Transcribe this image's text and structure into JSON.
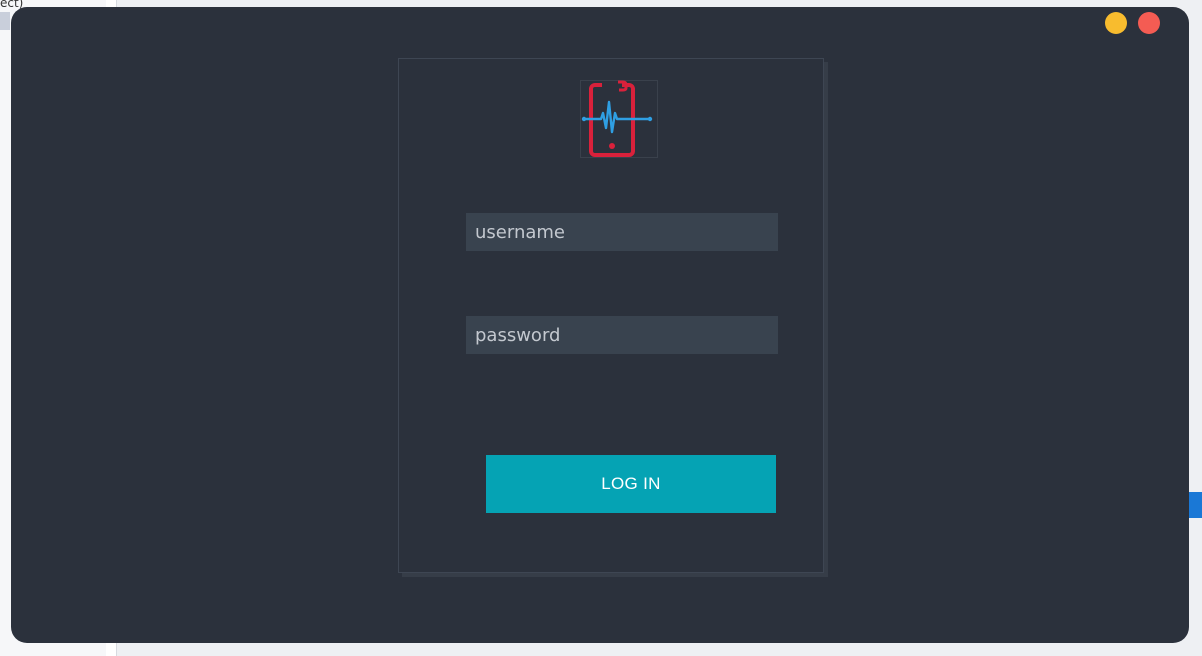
{
  "background": {
    "left_panel_text": "ect)"
  },
  "window": {
    "controls": {
      "minimize_color": "#f8bc2e",
      "close_color": "#f45c53"
    }
  },
  "login": {
    "logo_icon": "phone-heartbeat-icon",
    "username": {
      "value": "",
      "placeholder": "username"
    },
    "password": {
      "value": "",
      "placeholder": "password"
    },
    "submit_label": "LOG IN",
    "accent_color": "#05a3b4"
  }
}
